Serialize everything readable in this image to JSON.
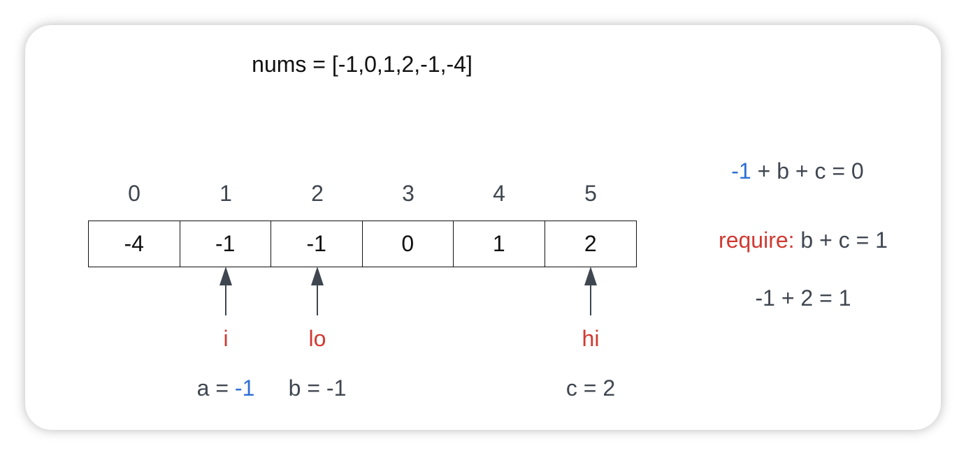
{
  "title": "nums = [-1,0,1,2,-1,-4]",
  "indices": [
    "0",
    "1",
    "2",
    "3",
    "4",
    "5"
  ],
  "cells": [
    "-4",
    "-1",
    "-1",
    "0",
    "1",
    "2"
  ],
  "pointers": {
    "i": "i",
    "lo": "lo",
    "hi": "hi"
  },
  "values": {
    "a_prefix": "a = ",
    "a_value": "-1",
    "b": "b = -1",
    "c": "c = 2"
  },
  "equations": {
    "eq1_value": "-1",
    "eq1_rest": " + b + c = 0",
    "eq2_label": "require:",
    "eq2_rest": " b + c = 1",
    "eq3": "-1 + 2 = 1"
  },
  "colors": {
    "pointer_label": "#d03a32",
    "highlight_value": "#2f6fd6",
    "arrow": "#3f4650"
  }
}
